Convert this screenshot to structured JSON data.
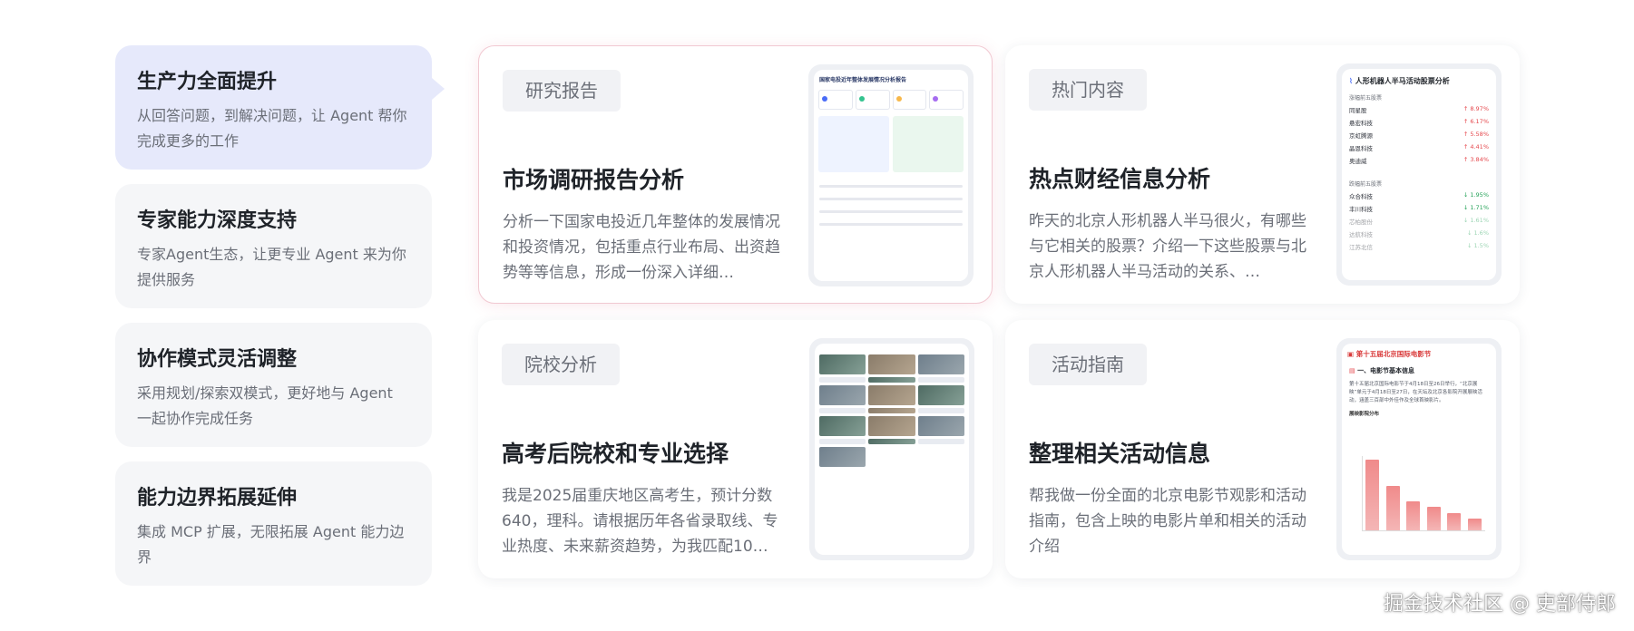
{
  "features": [
    {
      "title": "生产力全面提升",
      "desc": "从回答问题，到解决问题，让 Agent 帮你完成更多的工作"
    },
    {
      "title": "专家能力深度支持",
      "desc": "专家Agent生态，让更专业 Agent 来为你提供服务"
    },
    {
      "title": "协作模式灵活调整",
      "desc": "采用规划/探索双模式，更好地与 Agent 一起协作完成任务"
    },
    {
      "title": "能力边界拓展延伸",
      "desc": "集成 MCP 扩展，无限拓展 Agent 能力边界"
    }
  ],
  "cards": [
    {
      "tag": "研究报告",
      "title": "市场调研报告分析",
      "desc": "分析一下国家电投近几年整体的发展情况和投资情况，包括重点行业布局、出资趋势等等信息，形成一份深入详细…"
    },
    {
      "tag": "热门内容",
      "title": "热点财经信息分析",
      "desc": "昨天的北京人形机器人半马很火，有哪些与它相关的股票？介绍一下这些股票与北京人形机器人半马活动的关系、…"
    },
    {
      "tag": "院校分析",
      "title": "高考后院校和专业选择",
      "desc": "我是2025届重庆地区高考生，预计分数640，理科。请根据历年各省录取线、专业热度、未来薪资趋势，为我匹配10…"
    },
    {
      "tag": "活动指南",
      "title": "整理相关活动信息",
      "desc": "帮我做一份全面的北京电影节观影和活动指南，包含上映的电影片单和相关的活动介绍"
    }
  ],
  "preview_report": {
    "title": "国家电投近年整体发展情况分析报告"
  },
  "preview_stocks": {
    "title": "人形机器人半马活动股票分析",
    "gain_label": "涨幅前五股票",
    "gainers": [
      {
        "name": "同星股",
        "change": "↑ 8.97%"
      },
      {
        "name": "悬宏科技",
        "change": "↑ 6.17%"
      },
      {
        "name": "京虹腾源",
        "change": "↑ 5.58%"
      },
      {
        "name": "晶恩科技",
        "change": "↑ 4.41%"
      },
      {
        "name": "奥迪威",
        "change": "↑ 3.84%"
      }
    ],
    "loss_label": "跌幅前五股票",
    "losers": [
      {
        "name": "众合科技",
        "change": "↓ 1.95%"
      },
      {
        "name": "丰川科技",
        "change": "↓ 1.71%"
      },
      {
        "name": "芯柏股份",
        "change": "↓ 1.61%"
      },
      {
        "name": "达航科技",
        "change": "↓ 1.6%"
      },
      {
        "name": "江苏北信",
        "change": "↓ 1.5%"
      }
    ]
  },
  "preview_film": {
    "title": "第十五届北京国际电影节",
    "section": "一、电影节基本信息",
    "text": "第十五届北京国际电影节于4月18日至26日举行，“北京展映”单元于4月18日至27日，在天坛及北京各影院开展展映活动，涵盖三百部中外佳作及全球首映影片。",
    "chart_label": "展映影院分布",
    "values": [
      12,
      7.5,
      5,
      4,
      3,
      2
    ]
  },
  "watermark": "掘金技术社区 @ 吏部侍郎"
}
